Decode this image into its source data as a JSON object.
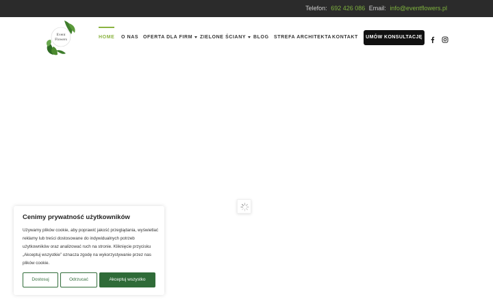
{
  "topbar": {
    "phone_label": "Telefon:",
    "phone_value": "692 426 086",
    "email_label": "Email:",
    "email_value": "info@eventflowers.pl"
  },
  "logo": {
    "line1": "Event",
    "line2": "Flowers"
  },
  "nav": {
    "items": [
      {
        "label": "HOME"
      },
      {
        "label": "O NAS"
      },
      {
        "label": "OFERTA DLA FIRM"
      },
      {
        "label": "ZIELONE ŚCIANY"
      },
      {
        "label": "BLOG"
      },
      {
        "label": "STREFA ARCHITEKTA"
      },
      {
        "label": "KONTAKT"
      }
    ],
    "cta_label": "UMÓW KONSULTACJĘ",
    "social": [
      "facebook-icon",
      "instagram-icon"
    ]
  },
  "cookie": {
    "title": "Cenimy prywatność użytkowników",
    "text": "Używamy plików cookie, aby poprawić jakość przeglądania, wyświetlać reklamy lub treści dostosowane do indywidualnych potrzeb użytkowników oraz analizować ruch na stronie. Kliknięcie przycisku „Akceptuj wszystkie” oznacza zgodę na wykorzystywanie przez nas plików cookie.",
    "buttons": {
      "customize": "Dostosuj",
      "reject": "Odrzucać",
      "accept": "Akceptuj wszystko"
    }
  },
  "colors": {
    "accent": "#8ab340",
    "dark": "#2b2b2b",
    "cookie_green": "#2f6b38"
  }
}
